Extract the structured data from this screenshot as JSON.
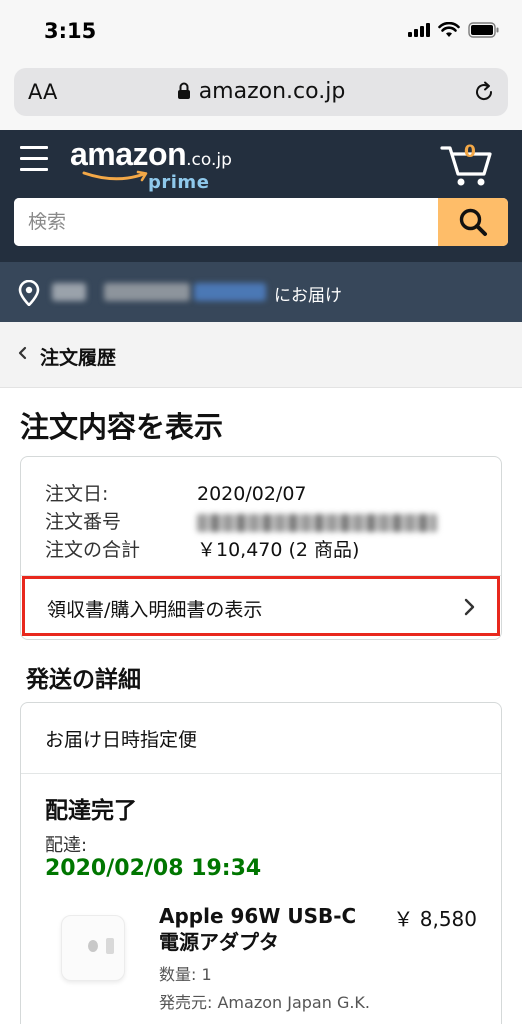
{
  "status_bar": {
    "time": "3:15"
  },
  "browser": {
    "text_size_label": "AA",
    "url": "amazon.co.jp"
  },
  "header": {
    "logo_text": "amazon",
    "logo_tld": ".co.jp",
    "logo_sub": "prime",
    "cart_count": "0",
    "search_placeholder": "検索"
  },
  "deliver_to": {
    "suffix": "にお届け"
  },
  "breadcrumb": {
    "label": "注文履歴"
  },
  "page": {
    "title": "注文内容を表示"
  },
  "order": {
    "date_label": "注文日:",
    "date_value": "2020/02/07",
    "number_label": "注文番号",
    "total_label": "注文の合計",
    "total_value": "￥10,470 (2 商品)",
    "receipt_link": "領収書/購入明細書の表示"
  },
  "shipment": {
    "section_title": "発送の詳細",
    "method": "お届け日時指定便",
    "status": "配達完了",
    "delivery_label": "配達:",
    "delivery_datetime": "2020/02/08 19:34",
    "status_color": "#007600",
    "item": {
      "name": "Apple 96W USB-C 電源アダプタ",
      "price": "￥ 8,580",
      "quantity": "数量: 1",
      "seller": "発売元: Amazon Japan G.K."
    }
  },
  "colors": {
    "header_bg": "#232f3e",
    "subheader_bg": "#37475a",
    "search_button": "#febd69",
    "highlight_border": "#e8281d"
  }
}
